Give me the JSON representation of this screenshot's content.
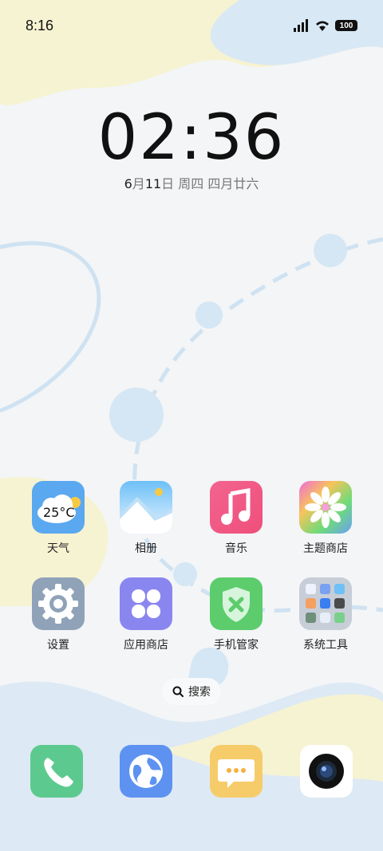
{
  "status_bar": {
    "time": "8:16",
    "battery": "100"
  },
  "lockscreen": {
    "clock": "02:36",
    "date_month": "6",
    "date_day": "11",
    "date_weekday": "日 周四",
    "lunar": "四月廿六"
  },
  "apps": [
    {
      "label": "天气",
      "icon": "weather-icon",
      "temp": "25°C"
    },
    {
      "label": "相册",
      "icon": "gallery-icon"
    },
    {
      "label": "音乐",
      "icon": "music-icon"
    },
    {
      "label": "主题商店",
      "icon": "theme-store-icon"
    },
    {
      "label": "设置",
      "icon": "gear-icon"
    },
    {
      "label": "应用商店",
      "icon": "app-store-icon"
    },
    {
      "label": "手机管家",
      "icon": "phone-manager-icon"
    },
    {
      "label": "系统工具",
      "icon": "folder-icon"
    }
  ],
  "search": {
    "label": "搜索"
  },
  "dock": [
    {
      "icon": "phone-icon"
    },
    {
      "icon": "browser-icon"
    },
    {
      "icon": "messages-icon"
    },
    {
      "icon": "camera-icon"
    }
  ],
  "colors": {
    "weather": "#5aa8f0",
    "music": "#f0507a",
    "settings": "#8fa2b8",
    "appstore": "#8a86f0",
    "manager": "#5ccc6c",
    "phone": "#5cca8e",
    "browser": "#5e92f0",
    "messages": "#f6cc6a"
  }
}
